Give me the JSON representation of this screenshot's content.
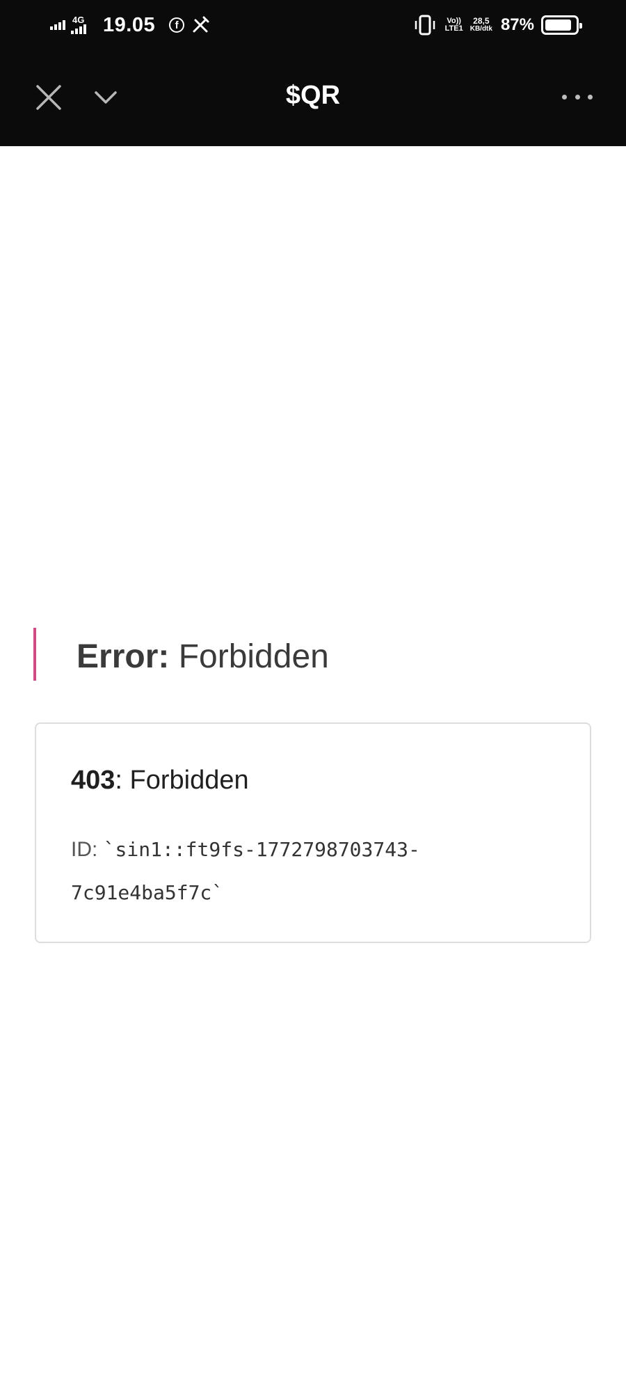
{
  "status_bar": {
    "network_type": "4G",
    "time": "19.05",
    "volte_top": "Vo))",
    "volte_bottom": "LTE1",
    "speed_value": "28,5",
    "speed_unit": "KB/dtk",
    "battery_percent": "87%",
    "battery_level": 0.87,
    "icons": [
      "signal-icon",
      "signal-4g-icon",
      "facebook-icon",
      "tools-icon",
      "vibrate-icon",
      "volte-icon",
      "battery-icon"
    ]
  },
  "app_bar": {
    "title": "$QR",
    "icons": [
      "close-icon",
      "chevron-down-icon",
      "more-icon"
    ]
  },
  "error": {
    "label": "Error:",
    "message": " Forbidden",
    "accent_color": "#d04a84"
  },
  "details": {
    "code": "403",
    "code_message": ": Forbidden",
    "id_label": "ID: ",
    "id_value": "`sin1::ft9fs-1772798703743-7c91e4ba5f7c`"
  }
}
